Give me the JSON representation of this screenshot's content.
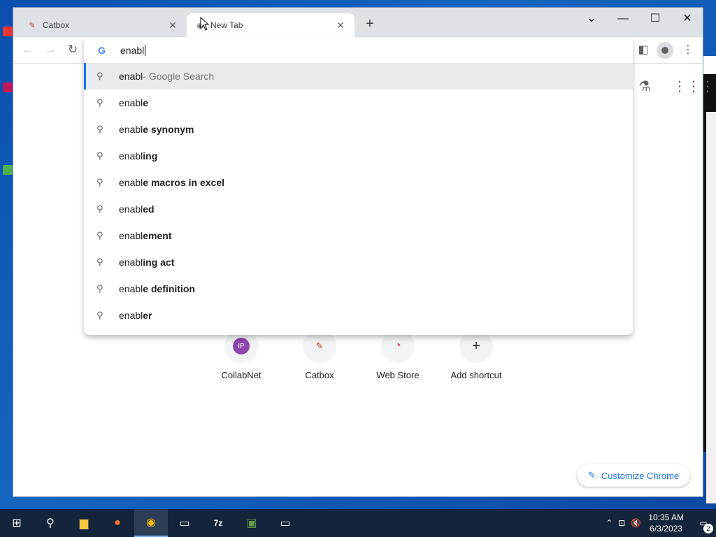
{
  "browser": {
    "tabs": [
      {
        "title": "Catbox",
        "active": false
      },
      {
        "title": "New Tab",
        "active": true
      }
    ],
    "omnibox": {
      "value": "enabl",
      "suggestions": [
        {
          "prefix": "enabl",
          "bold": "",
          "suffix": " - Google Search",
          "highlight": true
        },
        {
          "prefix": "enable",
          "bold": "e",
          "suffix": ""
        },
        {
          "prefix": "enable",
          "bold": "e synonym",
          "suffix": ""
        },
        {
          "prefix": "enabl",
          "bold": "ing",
          "suffix": ""
        },
        {
          "prefix": "enable",
          "bold": "e macros in excel",
          "suffix": ""
        },
        {
          "prefix": "enabl",
          "bold": "ed",
          "suffix": ""
        },
        {
          "prefix": "enabl",
          "bold": "ement",
          "suffix": ""
        },
        {
          "prefix": "enabl",
          "bold": "ing act",
          "suffix": ""
        },
        {
          "prefix": "enable",
          "bold": "e definition",
          "suffix": ""
        },
        {
          "prefix": "enabl",
          "bold": "er",
          "suffix": ""
        }
      ]
    },
    "shortcuts": [
      {
        "label": "CollabNet",
        "icon": "IP"
      },
      {
        "label": "Catbox",
        "icon": "catbox-icon"
      },
      {
        "label": "Web Store",
        "icon": "webstore-icon"
      },
      {
        "label": "Add shortcut",
        "icon": "+"
      }
    ],
    "customize_label": "Customize Chrome"
  },
  "taskbar": {
    "time": "10:35 AM",
    "date": "6/3/2023",
    "notifications": "2"
  },
  "colors": {
    "accent": "#1a73e8",
    "taskbar": "#14243a"
  }
}
